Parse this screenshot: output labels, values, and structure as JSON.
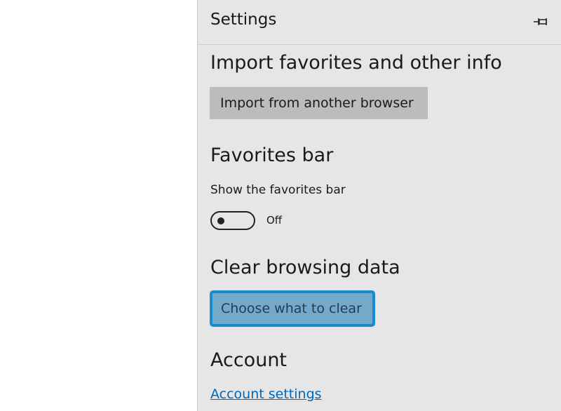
{
  "panel": {
    "title": "Settings",
    "pin_icon": "pin-icon"
  },
  "import_section": {
    "heading": "Import favorites and other info",
    "button_label": "Import from another browser"
  },
  "favorites_bar_section": {
    "heading": "Favorites bar",
    "toggle_label": "Show the favorites bar",
    "toggle_state": "Off",
    "toggle_on": false
  },
  "clear_data_section": {
    "heading": "Clear browsing data",
    "button_label": "Choose what to clear"
  },
  "account_section": {
    "heading": "Account",
    "link_label": "Account settings"
  },
  "colors": {
    "panel_background": "#e6e6e6",
    "gray_button": "#bcbcbc",
    "focused_button_fill": "#75a9c9",
    "focus_ring": "#1a8ad0",
    "link": "#0067b8"
  }
}
